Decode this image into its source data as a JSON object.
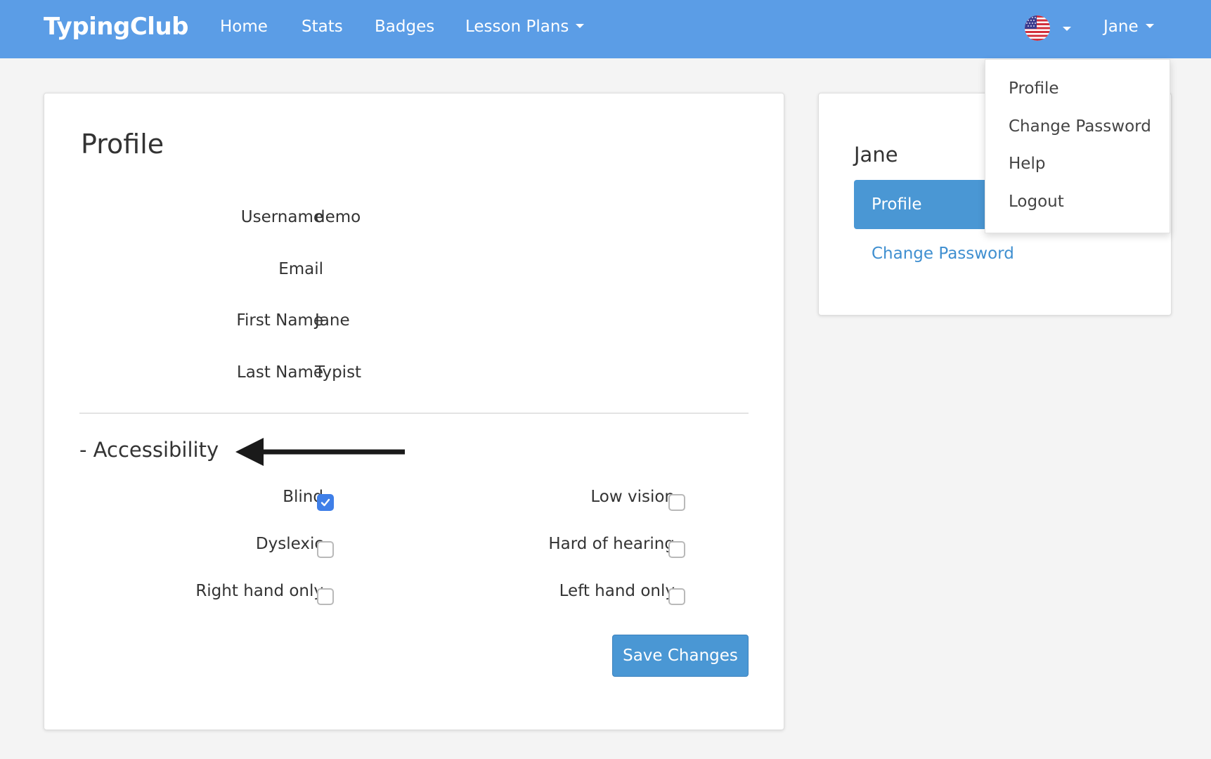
{
  "navbar": {
    "brand": "TypingClub",
    "links": [
      "Home",
      "Stats",
      "Badges",
      "Lesson Plans"
    ],
    "user": "Jane",
    "language_icon": "us-flag-icon",
    "color": "#5b9de6"
  },
  "profile": {
    "title": "Profile",
    "fields": [
      {
        "label": "Username",
        "value": "demo"
      },
      {
        "label": "Email",
        "value": ""
      },
      {
        "label": "First Name",
        "value": "Jane"
      },
      {
        "label": "Last Name",
        "value": "Typist"
      }
    ]
  },
  "accessibility": {
    "title": "- Accessibility",
    "options": [
      {
        "label": "Blind",
        "checked": true
      },
      {
        "label": "Low vision",
        "checked": false
      },
      {
        "label": "Dyslexic",
        "checked": false
      },
      {
        "label": "Hard of hearing",
        "checked": false
      },
      {
        "label": "Right hand only",
        "checked": false
      },
      {
        "label": "Left hand only",
        "checked": false
      }
    ],
    "save_label": "Save Changes"
  },
  "sidebar": {
    "name": "Jane",
    "active": "Profile",
    "link": "Change Password"
  },
  "user_dropdown": {
    "items": [
      "Profile",
      "Change Password",
      "Help",
      "Logout"
    ]
  },
  "colors": {
    "accent": "#4a97d4",
    "checkbox_checked": "#3f7fe8",
    "link": "#3f8fd0"
  }
}
